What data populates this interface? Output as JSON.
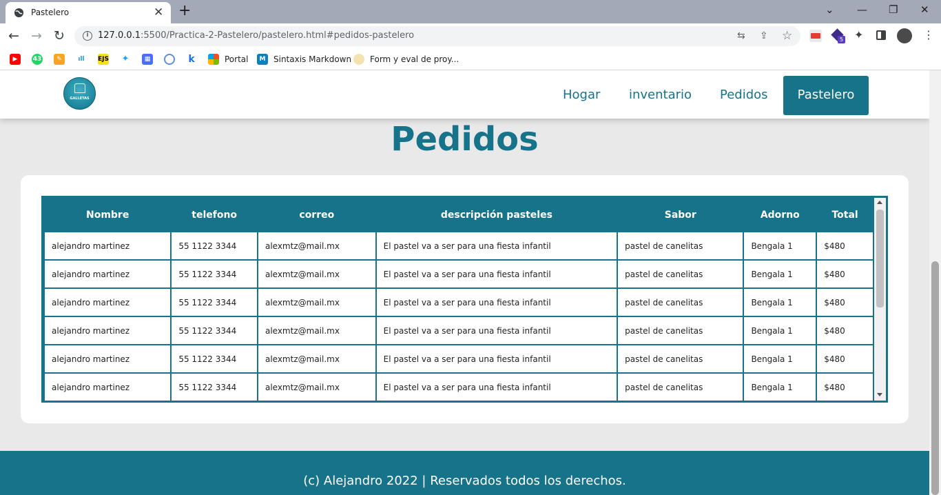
{
  "browser": {
    "tab_title": "Pastelero",
    "new_tab": "+",
    "tab_close": "✕",
    "url_host": "127.0.0.1",
    "url_path": ":5500/Practica-2-Pastelero/pastelero.html#pedidos-pastelero",
    "window_controls": {
      "collapse": "⌄",
      "minimize": "—",
      "restore": "❐",
      "close": "✕"
    },
    "nav": {
      "back": "←",
      "forward": "→",
      "reload": "↻"
    },
    "omnibox_icons": {
      "translate": "⇆",
      "share": "⇪",
      "star": "☆"
    },
    "extensions_badge": "5",
    "bookmarks": [
      {
        "label": "Portal"
      },
      {
        "label": "Sintaxis Markdown"
      },
      {
        "label": "Form y eval de proy..."
      }
    ],
    "bookmark_icons": [
      "youtube-icon",
      "whatsapp-icon",
      "pencil-icon",
      "cisco-icon",
      "ejs-icon",
      "twitter-icon",
      "codepen-icon",
      "chrome-icon",
      "k-icon"
    ]
  },
  "site": {
    "logo_text": "GALLETAS",
    "nav": {
      "home": "Hogar",
      "inventory": "inventario",
      "orders": "Pedidos",
      "baker": "Pastelero"
    },
    "page_title": "Pedidos",
    "table": {
      "headers": [
        "Nombre",
        "telefono",
        "correo",
        "descripción pasteles",
        "Sabor",
        "Adorno",
        "Total"
      ],
      "rows": [
        [
          "alejandro martinez",
          "55 1122 3344",
          "alexmtz@mail.mx",
          "El pastel va a ser para una fiesta infantil",
          "pastel de canelitas",
          "Bengala 1",
          "$480"
        ],
        [
          "alejandro martinez",
          "55 1122 3344",
          "alexmtz@mail.mx",
          "El pastel va a ser para una fiesta infantil",
          "pastel de canelitas",
          "Bengala 1",
          "$480"
        ],
        [
          "alejandro martinez",
          "55 1122 3344",
          "alexmtz@mail.mx",
          "El pastel va a ser para una fiesta infantil",
          "pastel de canelitas",
          "Bengala 1",
          "$480"
        ],
        [
          "alejandro martinez",
          "55 1122 3344",
          "alexmtz@mail.mx",
          "El pastel va a ser para una fiesta infantil",
          "pastel de canelitas",
          "Bengala 1",
          "$480"
        ],
        [
          "alejandro martinez",
          "55 1122 3344",
          "alexmtz@mail.mx",
          "El pastel va a ser para una fiesta infantil",
          "pastel de canelitas",
          "Bengala 1",
          "$480"
        ],
        [
          "alejandro martinez",
          "55 1122 3344",
          "alexmtz@mail.mx",
          "El pastel va a ser para una fiesta infantil",
          "pastel de canelitas",
          "Bengala 1",
          "$480"
        ]
      ]
    },
    "footer": "(c) Alejandro 2022 | Reservados todos los derechos."
  },
  "colors": {
    "brand": "#16738a",
    "page_bg": "#e9e9ea",
    "card_bg": "#ffffff"
  }
}
